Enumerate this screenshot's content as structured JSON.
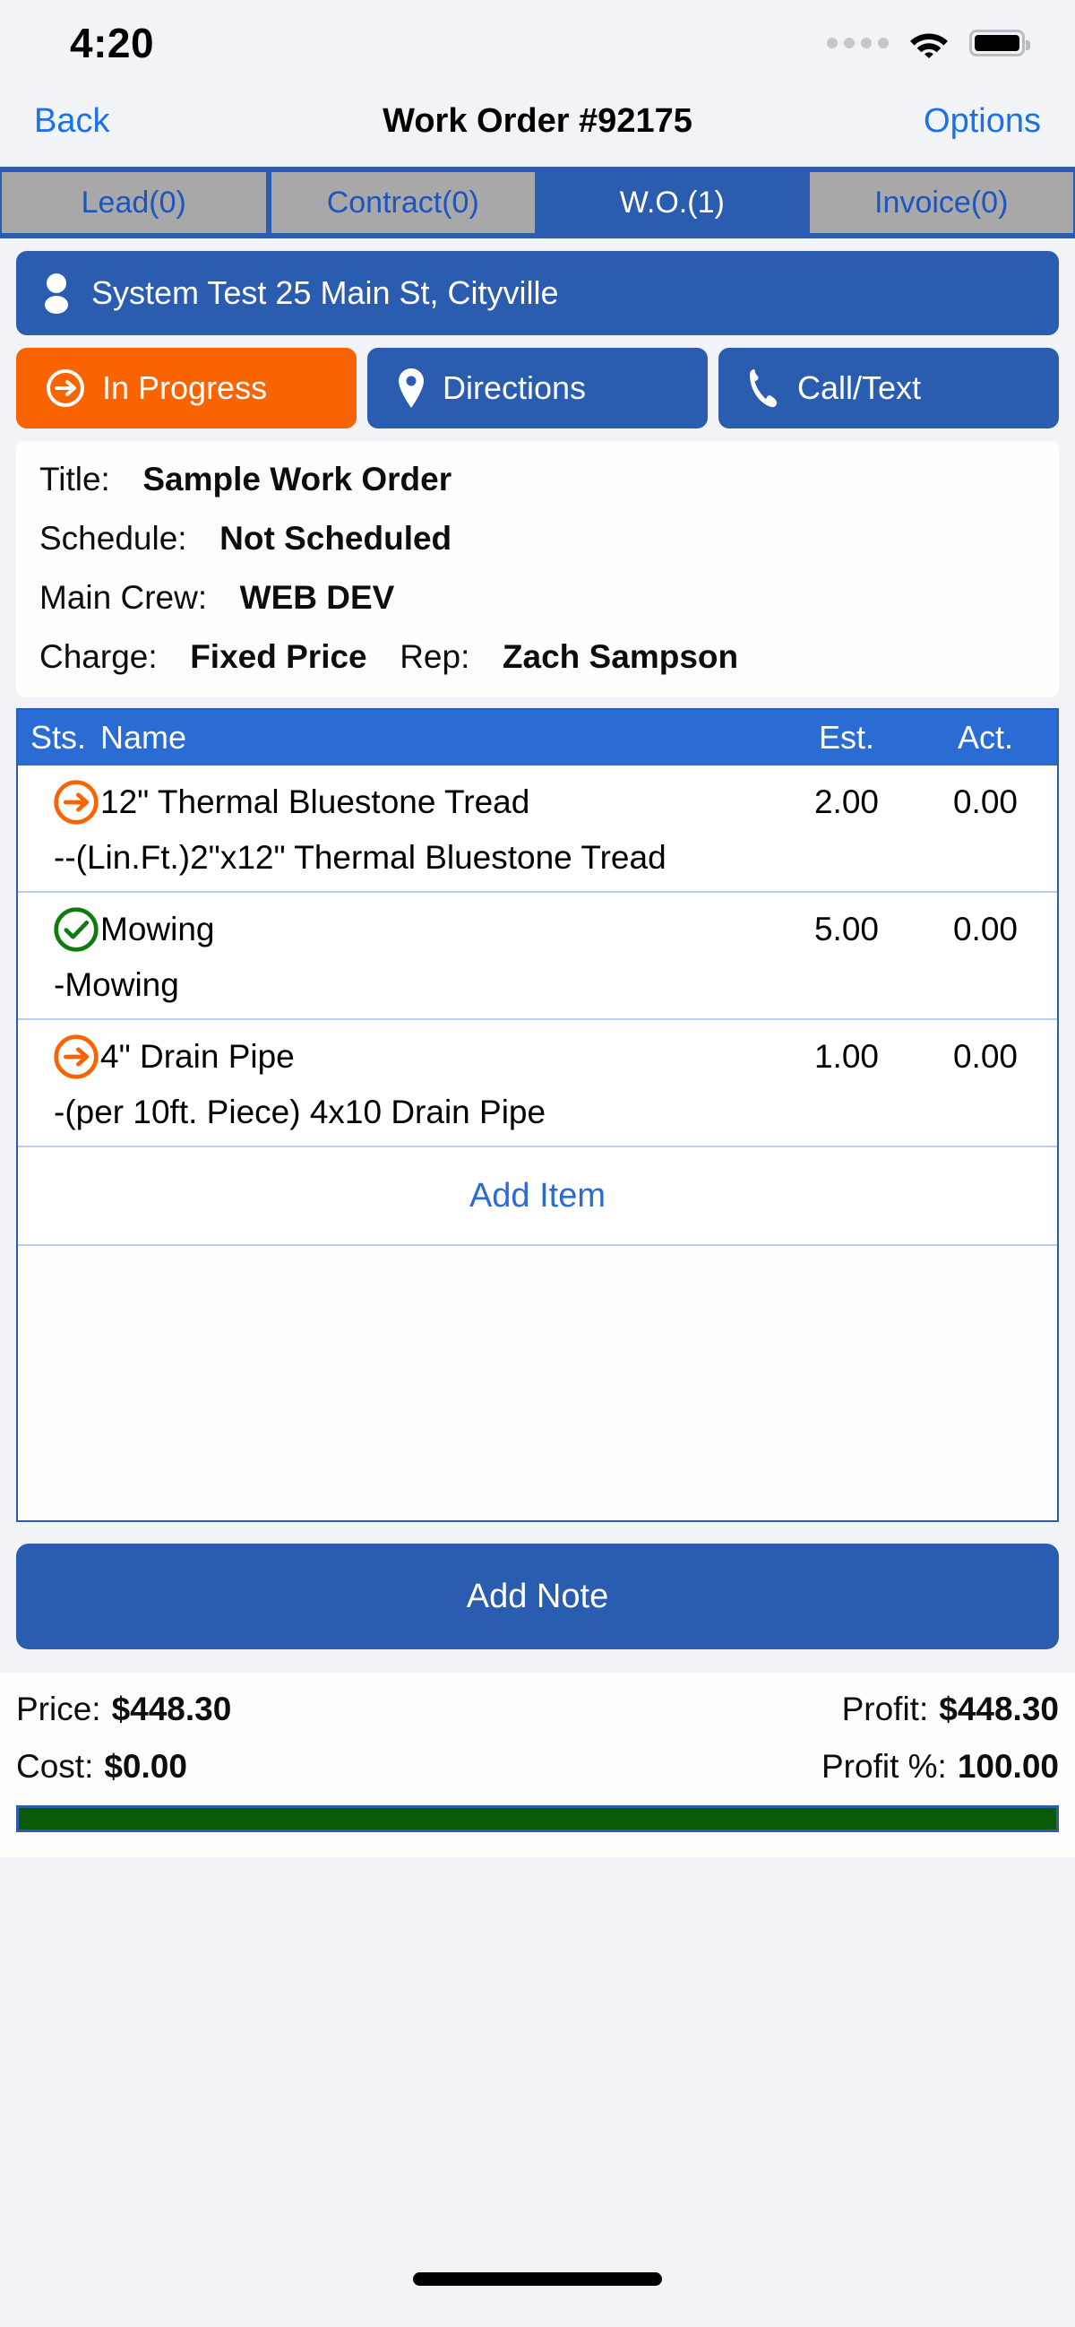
{
  "status_bar": {
    "time": "4:20",
    "signal_icon": "signal-dots-icon",
    "wifi_icon": "wifi-icon",
    "battery_icon": "battery-full-icon"
  },
  "nav": {
    "back_label": "Back",
    "title": "Work Order #92175",
    "options_label": "Options"
  },
  "tabs": [
    {
      "label": "Lead(0)",
      "active": false
    },
    {
      "label": "Contract(0)",
      "active": false
    },
    {
      "label": "W.O.(1)",
      "active": true
    },
    {
      "label": "Invoice(0)",
      "active": false
    }
  ],
  "customer": {
    "icon": "person-icon",
    "name": "System Test 25 Main St, Cityville"
  },
  "actions": [
    {
      "label": "In Progress",
      "icon": "arrow-right-circle-icon",
      "color": "#fa6400"
    },
    {
      "label": "Directions",
      "icon": "map-pin-icon",
      "color": "#2a5cb0"
    },
    {
      "label": "Call/Text",
      "icon": "phone-icon",
      "color": "#2a5cb0"
    }
  ],
  "details": {
    "title_label": "Title:",
    "title_value": "Sample Work Order",
    "schedule_label": "Schedule:",
    "schedule_value": "Not Scheduled",
    "crew_label": "Main Crew:",
    "crew_value": "WEB DEV",
    "charge_label": "Charge:",
    "charge_value": "Fixed Price",
    "rep_label": "Rep:",
    "rep_value": "Zach Sampson"
  },
  "items_table": {
    "headers": {
      "sts": "Sts.",
      "name": "Name",
      "est": "Est.",
      "act": "Act."
    },
    "rows": [
      {
        "status_icon": "arrow-right-circle-icon",
        "status_color": "#fa6400",
        "name": "12\" Thermal Bluestone Tread",
        "est": "2.00",
        "act": "0.00",
        "description": "--(Lin.Ft.)2\"x12\" Thermal Bluestone Tread"
      },
      {
        "status_icon": "check-circle-icon",
        "status_color": "#0f7a10",
        "name": "Mowing",
        "est": "5.00",
        "act": "0.00",
        "description": "-Mowing"
      },
      {
        "status_icon": "arrow-right-circle-icon",
        "status_color": "#fa6400",
        "name": "4\" Drain Pipe",
        "est": "1.00",
        "act": "0.00",
        "description": "-(per 10ft. Piece) 4x10 Drain Pipe"
      }
    ],
    "add_item_label": "Add Item"
  },
  "add_note_label": "Add Note",
  "summary": {
    "price_label": "Price:",
    "price_value": "$448.30",
    "profit_label": "Profit:",
    "profit_value": "$448.30",
    "cost_label": "Cost:",
    "cost_value": "$0.00",
    "profit_pct_label": "Profit %:",
    "profit_pct_value": "100.00",
    "progress_percent": 100,
    "progress_color": "#0a5a08"
  }
}
